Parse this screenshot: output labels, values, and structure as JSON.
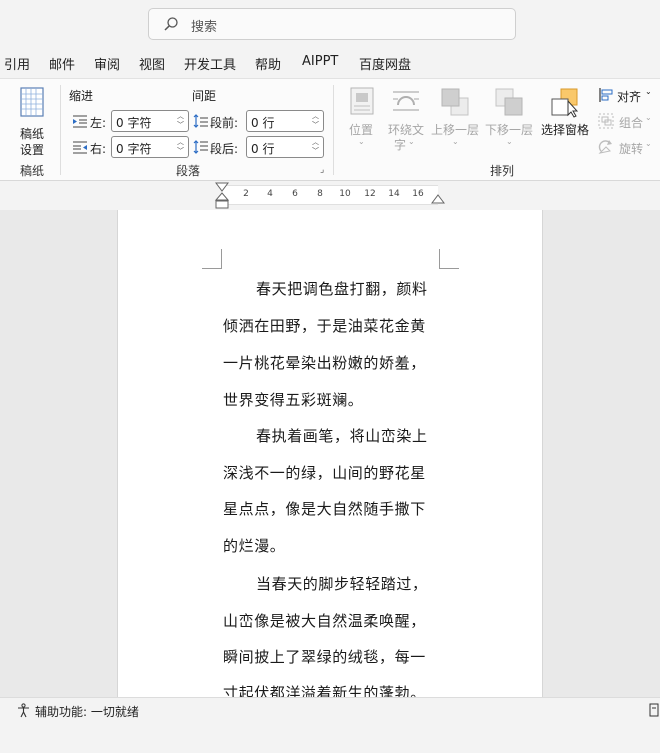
{
  "search": {
    "placeholder": "搜索"
  },
  "tabs": [
    "引用",
    "邮件",
    "审阅",
    "视图",
    "开发工具",
    "帮助",
    "AIPPT",
    "百度网盘"
  ],
  "ribbon": {
    "gaozhi_button": {
      "line1": "稿纸",
      "line2": "设置"
    },
    "gaozhi_group": "稿纸",
    "indent": {
      "title": "缩进",
      "left_label": "左:",
      "left_value": "0 字符",
      "right_label": "右:",
      "right_value": "0 字符"
    },
    "spacing": {
      "title": "间距",
      "before_label": "段前:",
      "before_value": "0 行",
      "after_label": "段后:",
      "after_value": "0 行"
    },
    "paragraph_group": "段落",
    "arrange": {
      "position": "位置",
      "wrap_line1": "环绕文",
      "wrap_line2": "字",
      "bring_forward": "上移一层",
      "send_backward": "下移一层",
      "selection_pane": "选择窗格",
      "align": "对齐",
      "group": "组合",
      "rotate": "旋转",
      "group_label": "排列"
    }
  },
  "ruler": {
    "ticks": [
      "2",
      "4",
      "6",
      "8",
      "10",
      "12",
      "14",
      "16"
    ]
  },
  "document": {
    "lines": [
      "春天把调色盘打翻，颜料",
      "倾洒在田野，于是油菜花金黄",
      "一片桃花晕染出粉嫩的娇羞，",
      "世界变得五彩斑斓。",
      "春执着画笔，将山峦染上",
      "深浅不一的绿，山间的野花星",
      "星点点，像是大自然随手撒下",
      "的烂漫。",
      "当春天的脚步轻轻踏过，",
      "山峦像是被大自然温柔唤醒，",
      "瞬间披上了翠绿的绒毯，每一",
      "寸起伏都洋溢着新生的蓬勃。"
    ]
  },
  "status": {
    "accessibility": "辅助功能: 一切就绪"
  }
}
